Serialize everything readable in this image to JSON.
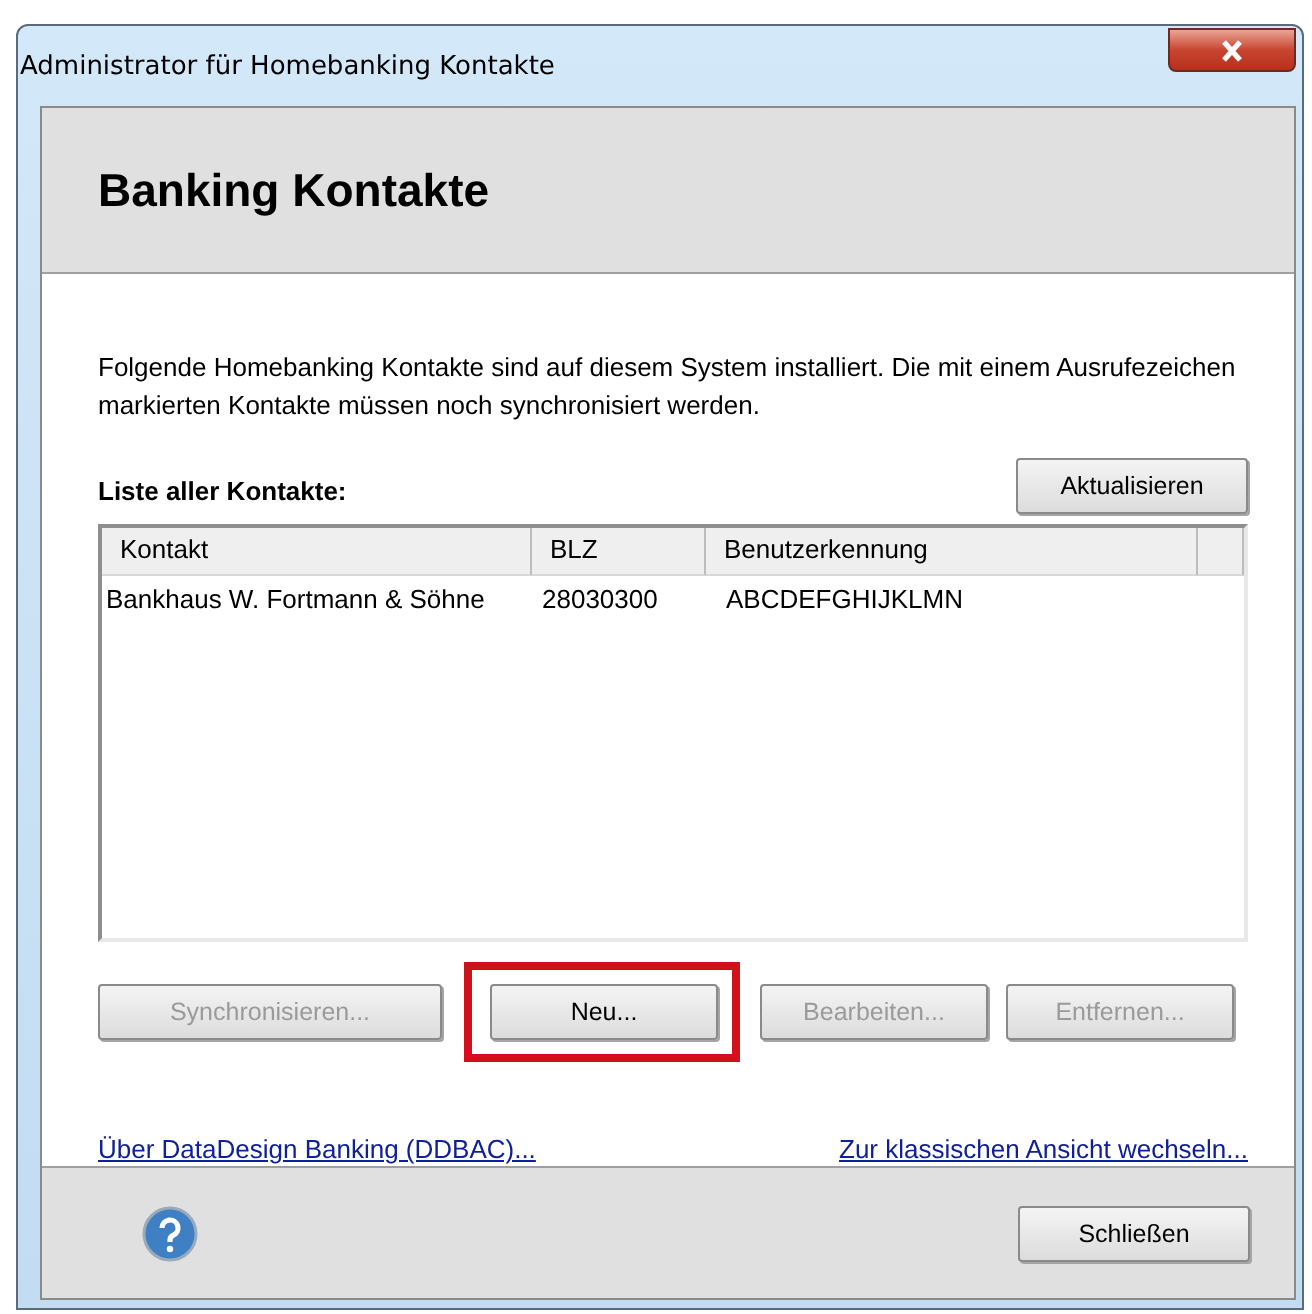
{
  "window": {
    "title": "Administrator für Homebanking Kontakte"
  },
  "header": {
    "title": "Banking Kontakte"
  },
  "description": "Folgende Homebanking Kontakte sind auf diesem System installiert. Die mit einem Ausrufezeichen markierten Kontakte müssen noch synchronisiert werden.",
  "list_label": "Liste aller Kontakte:",
  "refresh_button": "Aktualisieren",
  "table": {
    "columns": [
      "Kontakt",
      "BLZ",
      "Benutzerkennung"
    ],
    "rows": [
      [
        "Bankhaus W. Fortmann & Söhne",
        "28030300",
        "ABCDEFGHIJKLMN"
      ]
    ]
  },
  "actions": [
    {
      "label": "Synchronisieren...",
      "disabled": true,
      "highlighted": false
    },
    {
      "label": "Neu...",
      "disabled": false,
      "highlighted": true
    },
    {
      "label": "Bearbeiten...",
      "disabled": true,
      "highlighted": false
    },
    {
      "label": "Entfernen...",
      "disabled": true,
      "highlighted": false
    }
  ],
  "links": [
    "Über DataDesign Banking (DDBAC)...",
    "Zur klassischen Ansicht wechseln..."
  ],
  "close_button": "Schließen"
}
